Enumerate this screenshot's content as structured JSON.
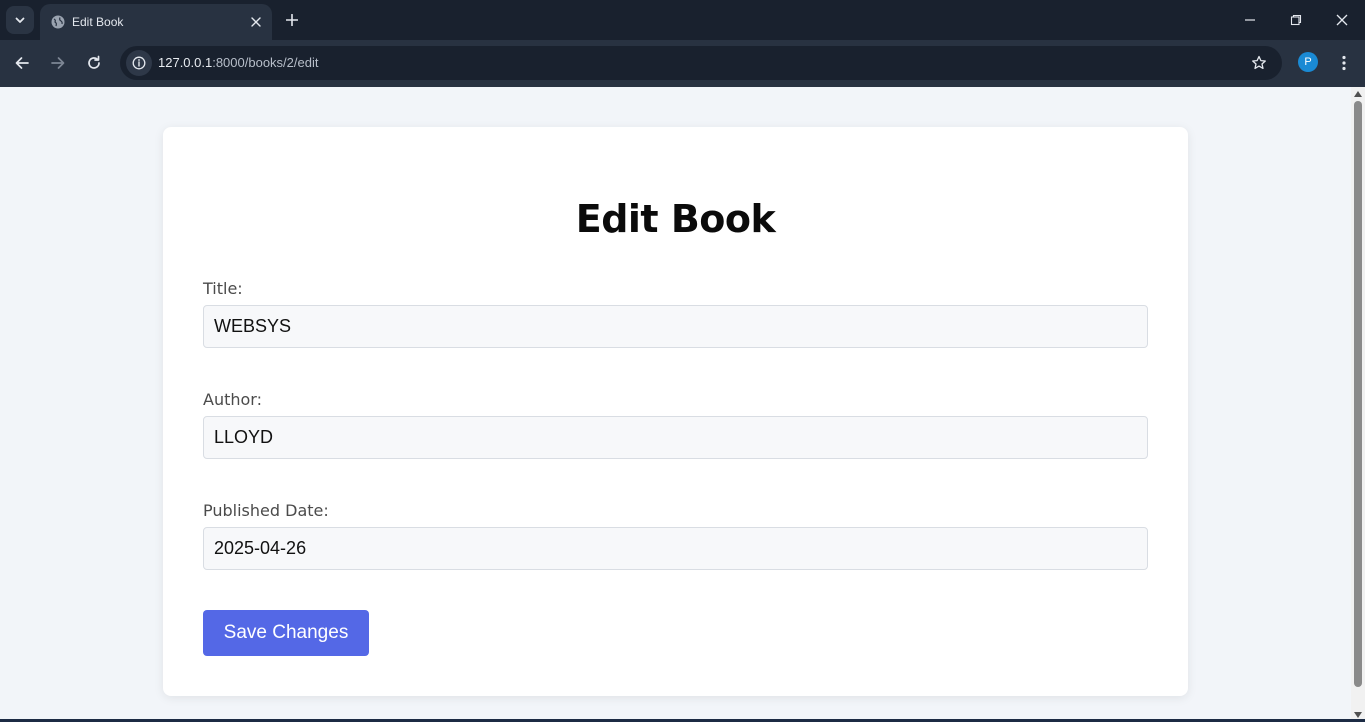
{
  "browser": {
    "tab_title": "Edit Book",
    "url_host": "127.0.0.1",
    "url_rest": ":8000/books/2/edit",
    "profile_initial": "P",
    "icons": {
      "tab_menu": "chevron-down-icon",
      "favicon": "globe-icon",
      "tab_close": "close-icon",
      "new_tab": "plus-icon",
      "back": "arrow-left-icon",
      "forward": "arrow-right-icon",
      "reload": "reload-icon",
      "site_info": "info-icon",
      "bookmark": "star-icon",
      "menu": "kebab-menu-icon",
      "minimize": "minimize-icon",
      "maximize": "restore-icon",
      "close_window": "close-icon"
    }
  },
  "page": {
    "title": "Edit Book",
    "fields": {
      "title": {
        "label": "Title:",
        "value": "WEBSYS"
      },
      "author": {
        "label": "Author:",
        "value": "LLOYD"
      },
      "published_date": {
        "label": "Published Date:",
        "value": "2025-04-26"
      }
    },
    "save_button_label": "Save Changes"
  },
  "colors": {
    "accent": "#5468e6",
    "chrome_dark": "#19212e",
    "chrome_toolbar": "#283241",
    "page_bg": "#f2f5f9",
    "profile": "#1a8ad4"
  }
}
